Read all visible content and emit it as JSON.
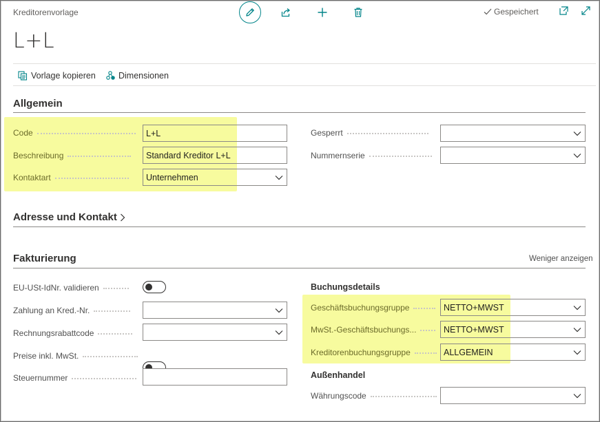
{
  "header": {
    "page_type": "Kreditorenvorlage",
    "saved_label": "Gespeichert",
    "title": "L+L"
  },
  "toolbar": {
    "copy_template": "Vorlage kopieren",
    "dimensions": "Dimensionen"
  },
  "general": {
    "title": "Allgemein",
    "code_label": "Code",
    "code_value": "L+L",
    "description_label": "Beschreibung",
    "description_value": "Standard Kreditor L+L",
    "contact_type_label": "Kontaktart",
    "contact_type_value": "Unternehmen",
    "blocked_label": "Gesperrt",
    "blocked_value": "",
    "number_series_label": "Nummernserie",
    "number_series_value": ""
  },
  "address": {
    "title": "Adresse und Kontakt"
  },
  "invoicing": {
    "title": "Fakturierung",
    "show_less": "Weniger anzeigen",
    "vat_validate_label": "EU-USt-IdNr. validieren",
    "vat_validate_on": false,
    "pay_to_label": "Zahlung an Kred.-Nr.",
    "pay_to_value": "",
    "invoice_disc_label": "Rechnungsrabattcode",
    "invoice_disc_value": "",
    "prices_incl_vat_label": "Preise inkl. MwSt.",
    "prices_incl_vat_on": false,
    "tax_number_label": "Steuernummer",
    "tax_number_value": "",
    "posting_details_heading": "Buchungsdetails",
    "gen_bus_posting_label": "Geschäftsbuchungsgruppe",
    "gen_bus_posting_value": "NETTO+MWST",
    "vat_bus_posting_label": "MwSt.-Geschäftsbuchungs...",
    "vat_bus_posting_value": "NETTO+MWST",
    "vendor_posting_label": "Kreditorenbuchungsgruppe",
    "vendor_posting_value": "ALLGEMEIN",
    "foreign_trade_heading": "Außenhandel",
    "currency_label": "Währungscode",
    "currency_value": ""
  },
  "colors": {
    "accent": "#008489",
    "highlight": "#f4f97e"
  }
}
